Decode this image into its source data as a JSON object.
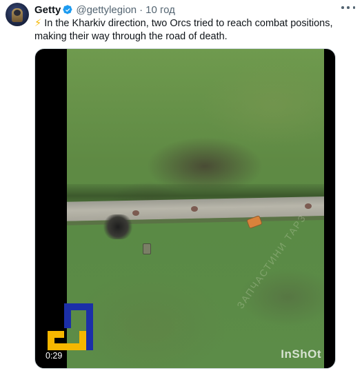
{
  "tweet": {
    "author_name": "Getty",
    "handle": "@gettylegion",
    "separator": "·",
    "time": "10 год",
    "emoji": "⚡",
    "text": " In the Kharkiv direction, two Orcs tried to reach combat positions, making their way through the road of death."
  },
  "media": {
    "duration": "0:29",
    "watermark": "InShOt",
    "overlay_text": "ЗАПЧАСТИНИ ТАРЗ"
  },
  "colors": {
    "verified_badge": "#1d9bf0",
    "handle_gray": "#536471",
    "logo_blue": "#1b2fa8",
    "logo_yellow": "#f6b700"
  },
  "icons": {
    "verified": "verified-badge-icon",
    "more": "more-options-icon"
  }
}
